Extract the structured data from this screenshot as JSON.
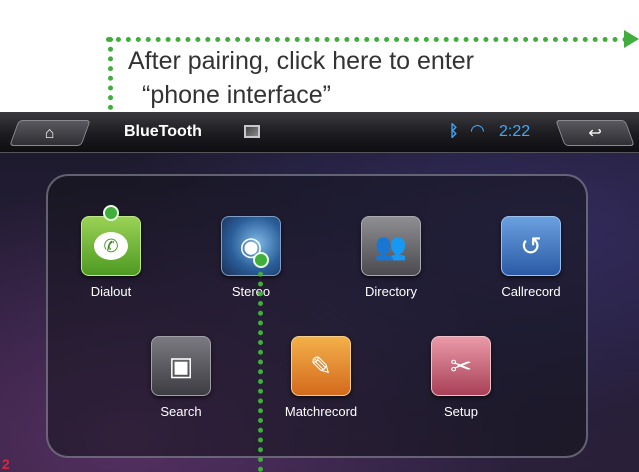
{
  "caption": {
    "line1": "After pairing, click here to enter",
    "line2": "“phone interface”"
  },
  "statusbar": {
    "title": "BlueTooth",
    "time": "2:22",
    "home_glyph": "⌂",
    "back_glyph": "↩",
    "bluetooth_glyph": "ᛒ",
    "wifi_glyph": "◠"
  },
  "icons": {
    "home": "home-icon",
    "back": "back-arrow-icon",
    "gallery": "image-icon",
    "bluetooth": "bluetooth-icon",
    "wifi": "wifi-icon"
  },
  "apps": [
    {
      "label": "Dialout",
      "icon": "phone-icon",
      "glyph": "✆"
    },
    {
      "label": "Stereo",
      "icon": "stereo-icon",
      "glyph": "◉"
    },
    {
      "label": "Directory",
      "icon": "contacts-icon",
      "glyph": "👥"
    },
    {
      "label": "Callrecord",
      "icon": "call-history-icon",
      "glyph": "↺"
    },
    {
      "label": "Search",
      "icon": "search-device-icon",
      "glyph": "▣"
    },
    {
      "label": "Matchrecord",
      "icon": "match-record-icon",
      "glyph": "✎"
    },
    {
      "label": "Setup",
      "icon": "setup-wrench-icon",
      "glyph": "✂"
    }
  ],
  "page_marker": "2",
  "colors": {
    "pointer_green": "#3fae3a",
    "status_blue": "#3fa9f5"
  }
}
